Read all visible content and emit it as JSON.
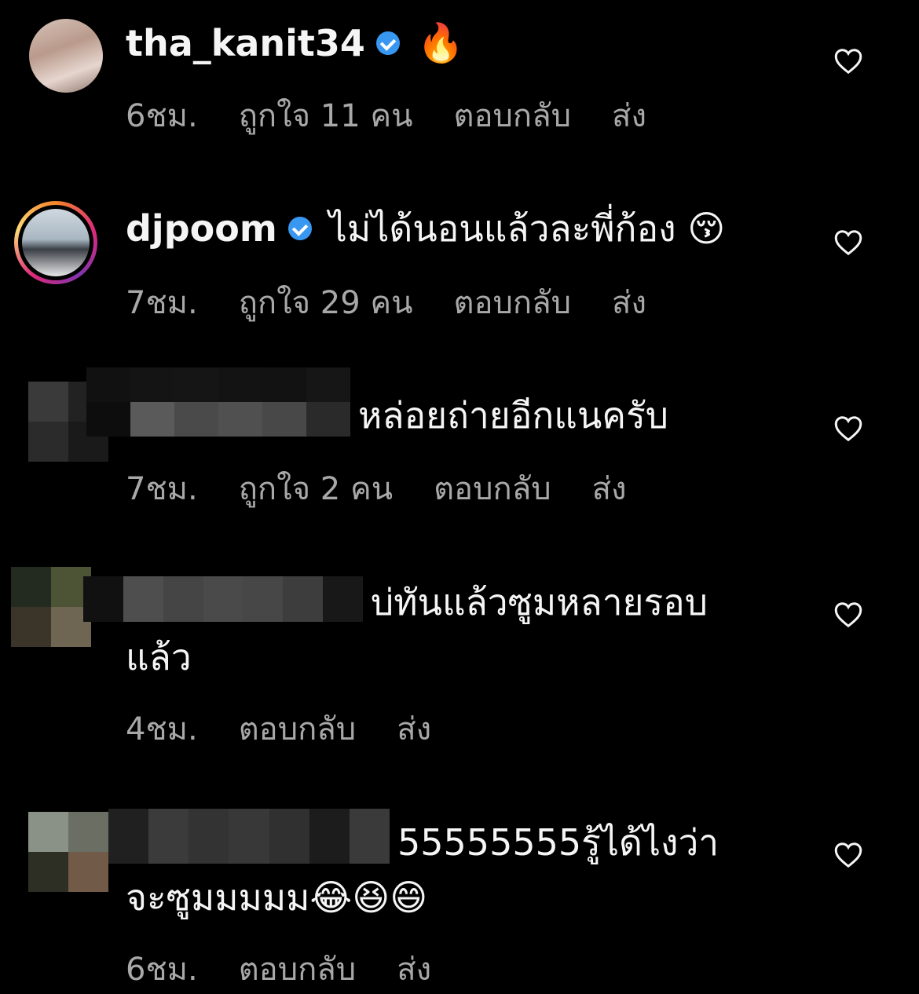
{
  "comments": [
    {
      "username": "tha_kanit34",
      "verified": true,
      "text": "🔥",
      "time": "6ชม.",
      "likes": "ถูกใจ 11 คน",
      "reply": "ตอบกลับ",
      "send": "ส่ง"
    },
    {
      "username": "djpoom",
      "verified": true,
      "text": "ไม่ได้นอนแล้วละพี่ก้อง 😚",
      "time": "7ชม.",
      "likes": "ถูกใจ 29 คน",
      "reply": "ตอบกลับ",
      "send": "ส่ง"
    },
    {
      "username": "",
      "verified": false,
      "text": "หล่อยถ่ายอีกแนครับ",
      "time": "7ชม.",
      "likes": "ถูกใจ 2 คน",
      "reply": "ตอบกลับ",
      "send": "ส่ง"
    },
    {
      "username": "",
      "verified": false,
      "text": "บ่ทันแล้วซูมหลายรอบ",
      "text_line2": "แล้ว",
      "time": "4ชม.",
      "reply": "ตอบกลับ",
      "send": "ส่ง"
    },
    {
      "username": "",
      "verified": false,
      "text": "55555555รู้ได้ไงว่า",
      "text_line2": "จะซูมมมมม😂😆😄",
      "time": "6ชม.",
      "reply": "ตอบกลับ",
      "send": "ส่ง"
    }
  ],
  "colors": {
    "background": "#000000",
    "text": "#f5f5f5",
    "meta": "#a8a8a8",
    "verified": "#3897f0"
  },
  "icons": {
    "like": "heart-outline-icon",
    "verified": "verified-badge-icon"
  }
}
